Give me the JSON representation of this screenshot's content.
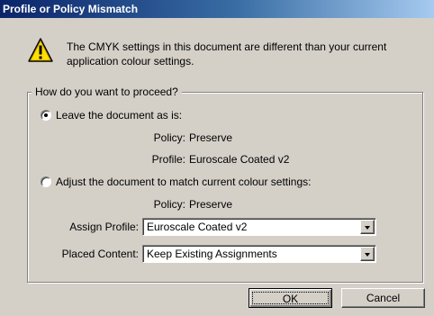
{
  "window": {
    "title": "Profile or Policy Mismatch"
  },
  "message": "The CMYK settings in this document are different than your current application colour settings.",
  "icons": {
    "warning": "warning-icon"
  },
  "group": {
    "legend": "How do you want to proceed?",
    "option_leave": {
      "label": "Leave the document as is:",
      "selected": true,
      "policy_label": "Policy:",
      "policy_value": "Preserve",
      "profile_label": "Profile:",
      "profile_value": "Euroscale Coated v2"
    },
    "option_adjust": {
      "label": "Adjust the document to match current colour settings:",
      "selected": false,
      "policy_label": "Policy:",
      "policy_value": "Preserve",
      "assign_profile_label": "Assign Profile:",
      "assign_profile_value": "Euroscale Coated v2",
      "placed_content_label": "Placed Content:",
      "placed_content_value": "Keep Existing Assignments"
    }
  },
  "buttons": {
    "ok": "OK",
    "cancel": "Cancel"
  },
  "colors": {
    "title_start": "#0a246a",
    "title_end": "#a6caf0",
    "face": "#d4d0c8",
    "warning": "#ffde00"
  }
}
